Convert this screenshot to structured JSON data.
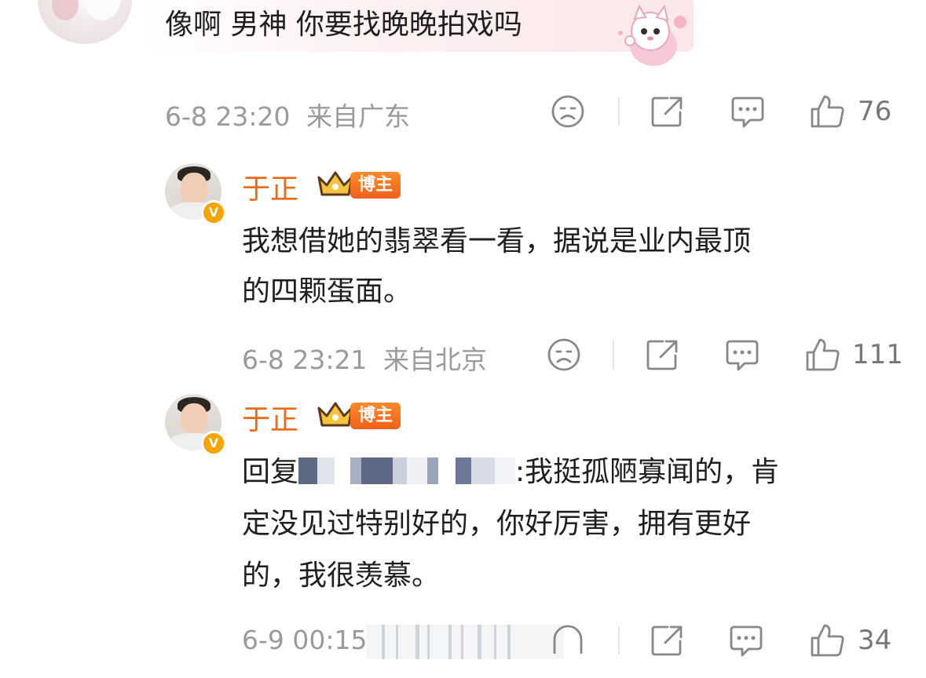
{
  "comments": [
    {
      "text": "像啊 男神 你要找晚晚拍戏吗",
      "time": "6-8 23:20",
      "location": "来自广东",
      "likes": "76"
    },
    {
      "author": "于正",
      "badge": "博主",
      "verified_mark": "V",
      "lines": [
        "我想借她的翡翠看一看，据说是业内最顶",
        "的四颗蛋面。"
      ],
      "time": "6-8 23:21",
      "location": "来自北京",
      "likes": "111"
    },
    {
      "author": "于正",
      "badge": "博主",
      "verified_mark": "V",
      "reply_prefix": "回复",
      "line1_rest": ":我挺孤陋寡闻的，肯",
      "lines": [
        "定没见过特别好的，你好厉害，拥有更好",
        "的，我很羡慕。"
      ],
      "time": "6-9 00:15",
      "likes": "34"
    }
  ],
  "icons": [
    "dislike-face-icon",
    "share-icon",
    "comment-icon",
    "thumbs-up-icon"
  ],
  "colors": {
    "name": "#f06a16",
    "meta": "#9a9a9a",
    "badge": "#f0601a",
    "verified": "#f5a400"
  }
}
